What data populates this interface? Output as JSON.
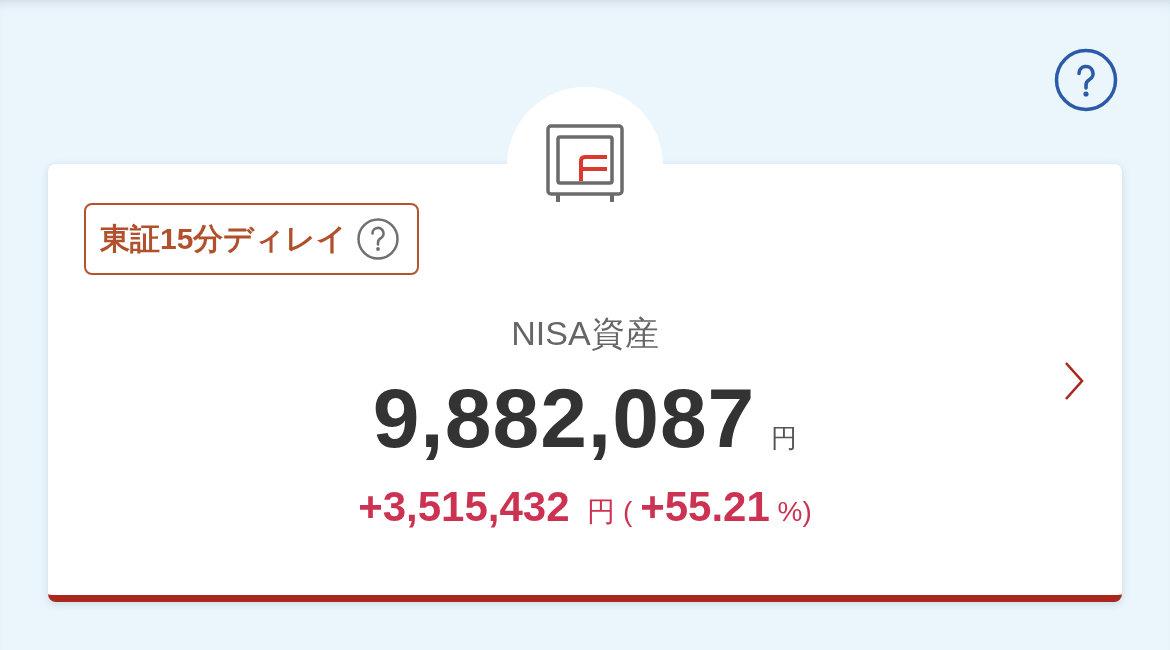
{
  "card": {
    "delay_notice": {
      "label": "東証15分ディレイ"
    },
    "title": "NISA資産",
    "total": {
      "amount": "9,882,087",
      "unit": "円"
    },
    "change": {
      "text": "**+3,515,432** 円 ( **+55.21** %)"
    }
  }
}
